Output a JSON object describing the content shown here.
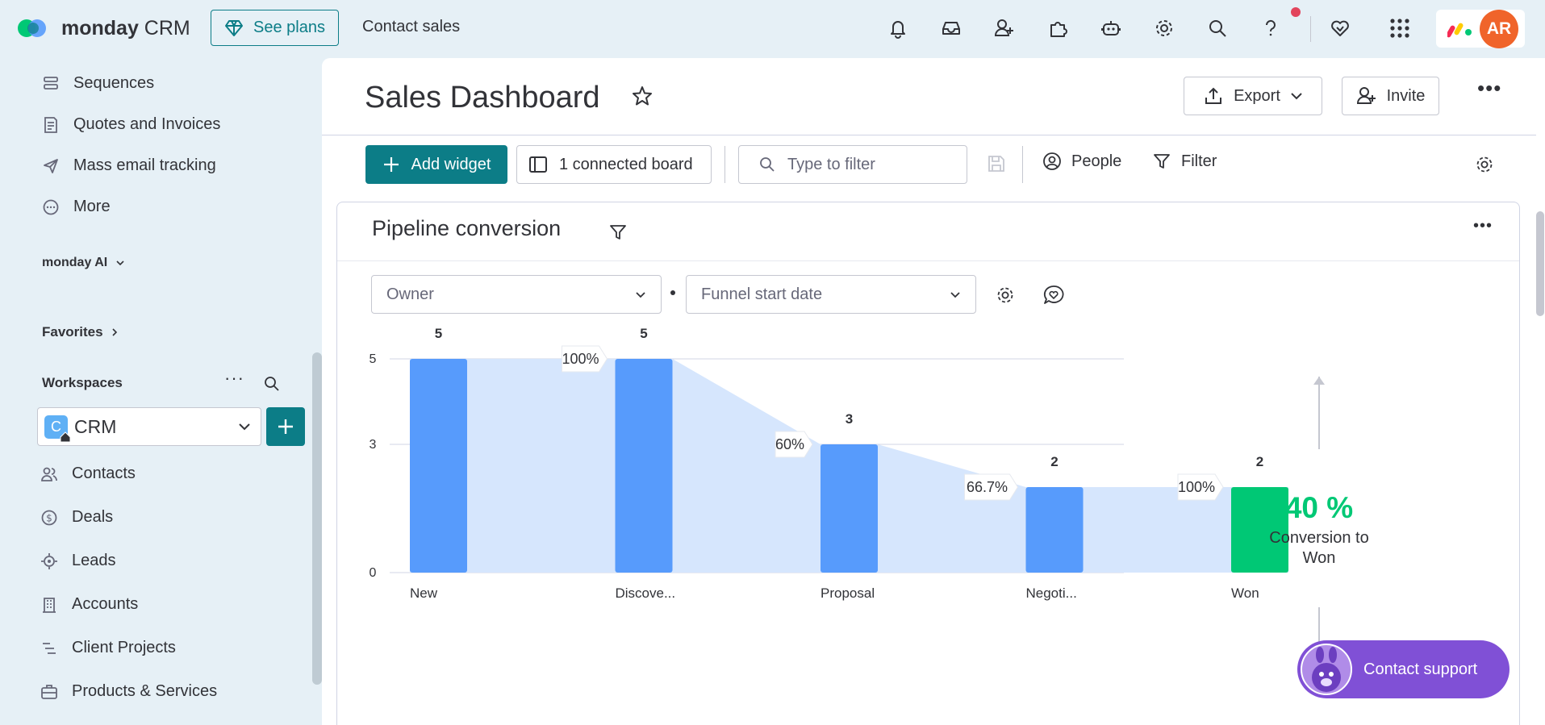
{
  "topbar": {
    "brand_bold": "monday",
    "brand_light": " CRM",
    "see_plans": "See plans",
    "contact_sales": "Contact sales",
    "avatar_initials": "AR",
    "icons": [
      "bell-icon",
      "inbox-icon",
      "invite-user-icon",
      "apps-puzzle-icon",
      "ai-bot-icon",
      "settings-gear-icon",
      "search-icon",
      "help-icon",
      "heart-icon",
      "app-grid-icon"
    ]
  },
  "sidebar": {
    "items_top": [
      {
        "label": "Sequences",
        "icon": "sequences-icon"
      },
      {
        "label": "Quotes and Invoices",
        "icon": "invoice-icon"
      },
      {
        "label": "Mass email tracking",
        "icon": "send-icon"
      },
      {
        "label": "More",
        "icon": "more-circle-icon"
      }
    ],
    "monday_ai": "monday AI",
    "favorites": "Favorites",
    "workspaces": "Workspaces",
    "workspace_badge": "C",
    "workspace_name": "CRM",
    "items": [
      {
        "label": "Contacts",
        "icon": "contacts-icon"
      },
      {
        "label": "Deals",
        "icon": "dollar-icon"
      },
      {
        "label": "Leads",
        "icon": "target-icon"
      },
      {
        "label": "Accounts",
        "icon": "building-icon"
      },
      {
        "label": "Client Projects",
        "icon": "projects-icon"
      },
      {
        "label": "Products & Services",
        "icon": "briefcase-icon"
      }
    ]
  },
  "header": {
    "title": "Sales Dashboard",
    "export": "Export",
    "invite": "Invite"
  },
  "toolbar": {
    "add_widget": "Add widget",
    "connected_board": "1 connected board",
    "filter_placeholder": "Type to filter",
    "people": "People",
    "filter": "Filter"
  },
  "widget": {
    "title": "Pipeline conversion",
    "owner_dropdown": "Owner",
    "date_dropdown": "Funnel start date",
    "kpi_value": "40 %",
    "kpi_label": "Conversion to Won"
  },
  "chart_data": {
    "type": "bar",
    "categories": [
      "New",
      "Discove...",
      "Proposal",
      "Negoti...",
      "Won"
    ],
    "values": [
      5,
      5,
      3,
      2,
      2
    ],
    "conversion_labels": [
      "100%",
      "60%",
      "66.7%",
      "100%"
    ],
    "yticks": [
      0,
      3,
      5
    ],
    "ylim": [
      0,
      5
    ],
    "colors": {
      "bar": "#579bfc",
      "won": "#00c875",
      "funnel": "#d6e6fd",
      "grid": "#d0d4e4"
    }
  },
  "support": {
    "label": "Contact support"
  }
}
